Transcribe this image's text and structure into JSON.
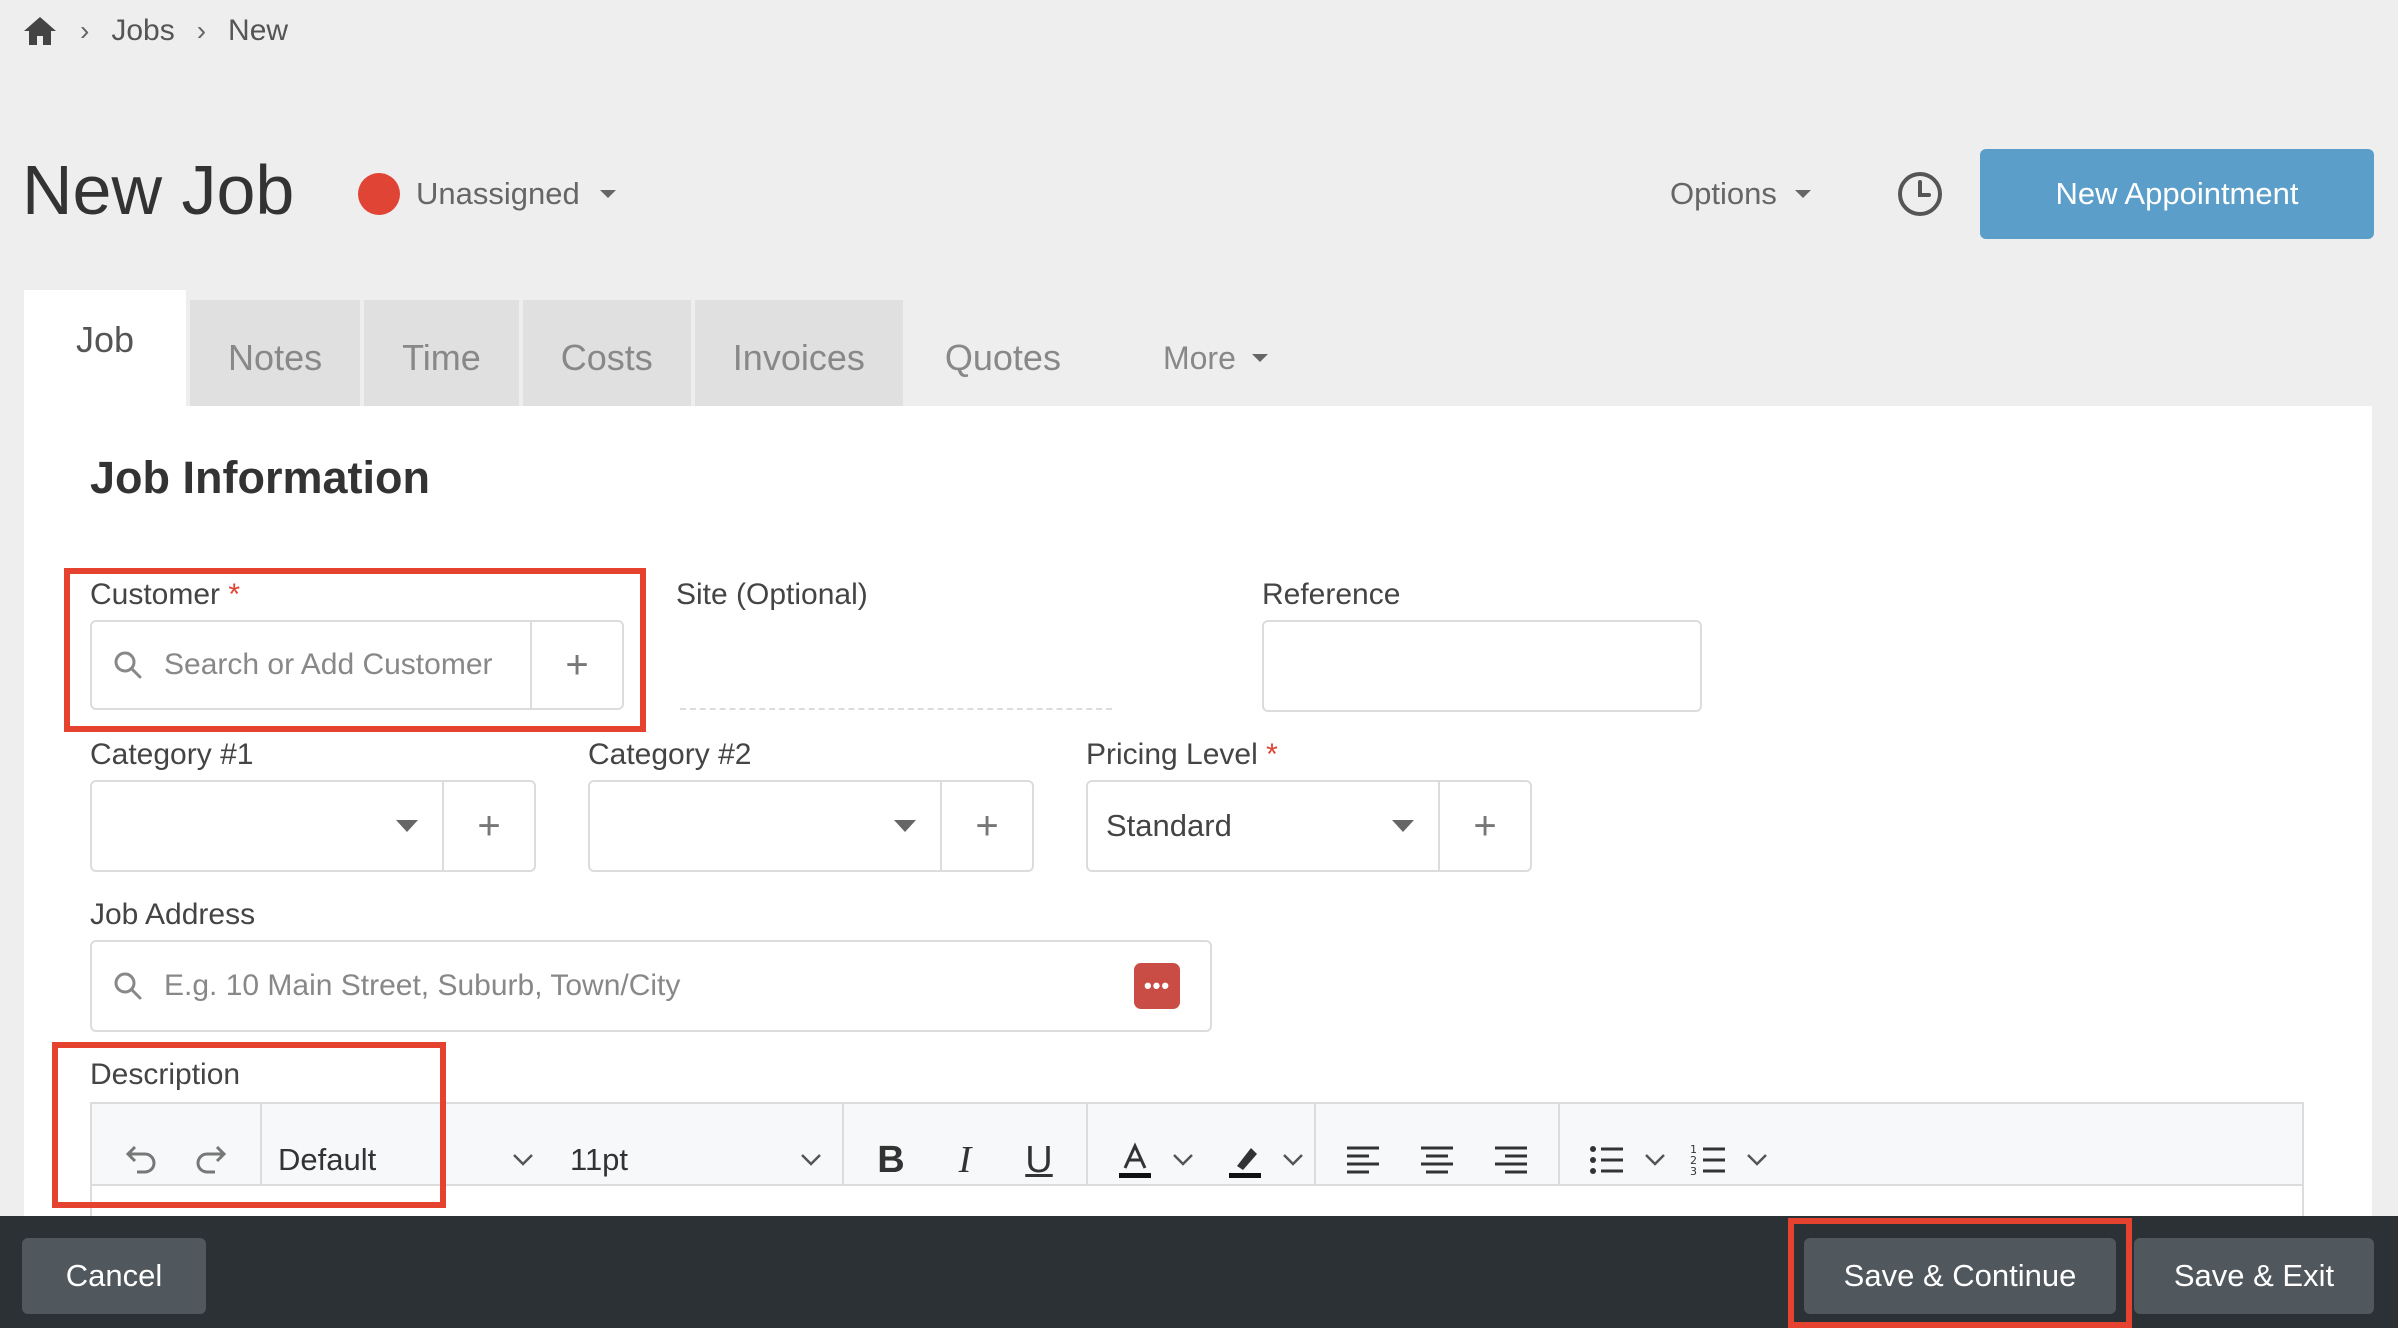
{
  "breadcrumb": {
    "items": [
      "Jobs",
      "New"
    ]
  },
  "header": {
    "title": "New Job",
    "status": "Unassigned",
    "options_label": "Options",
    "new_appointment_label": "New Appointment"
  },
  "tabs": [
    "Job",
    "Notes",
    "Time",
    "Costs",
    "Invoices",
    "Quotes",
    "More"
  ],
  "form": {
    "section_title": "Job Information",
    "customer_label": "Customer",
    "required_mark": "*",
    "customer_placeholder": "Search or Add Customer",
    "site_label": "Site (Optional)",
    "reference_label": "Reference",
    "category1_label": "Category #1",
    "category2_label": "Category #2",
    "pricing_label": "Pricing Level",
    "pricing_value": "Standard",
    "address_label": "Job Address",
    "address_placeholder": "E.g. 10 Main Street, Suburb, Town/City",
    "description_label": "Description",
    "editor": {
      "format": "Default",
      "font_size": "11pt"
    }
  },
  "footer": {
    "cancel_label": "Cancel",
    "save_continue_label": "Save & Continue",
    "save_exit_label": "Save & Exit"
  },
  "colors": {
    "accent": "#5b9ec9",
    "status_dot": "#e04434",
    "highlight": "#e5432f",
    "footer": "#2c3135"
  }
}
